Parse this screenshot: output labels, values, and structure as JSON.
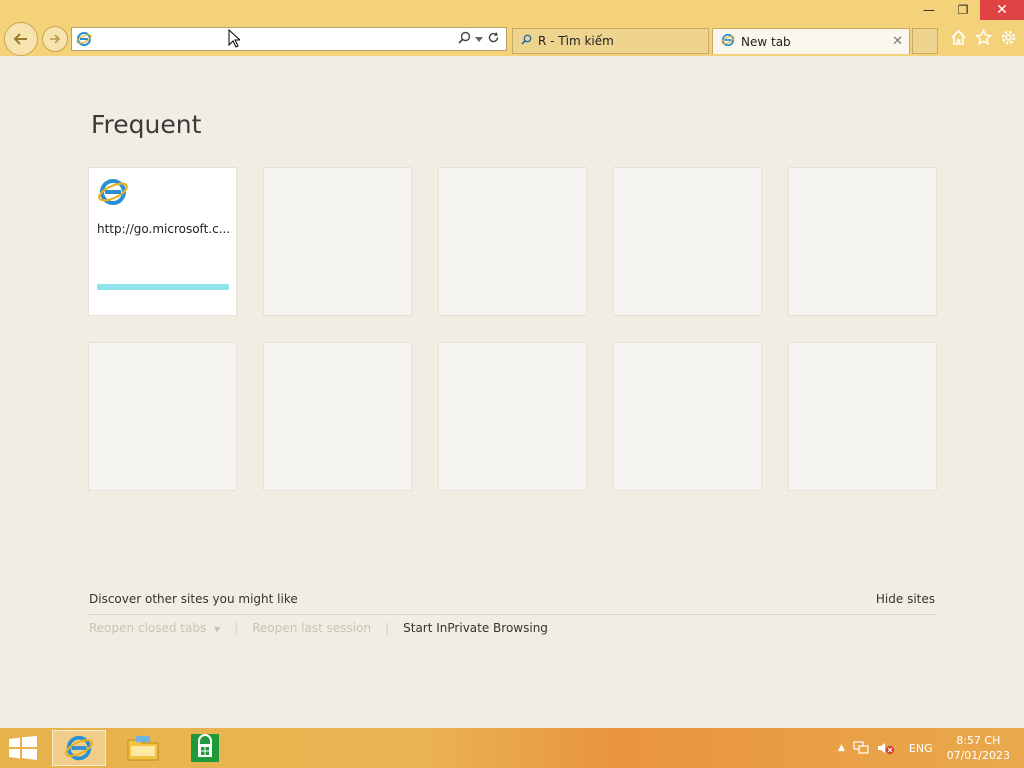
{
  "window": {
    "minimize": "—",
    "restore": "❐",
    "close": "✕"
  },
  "address_bar": {
    "value": "",
    "placeholder": ""
  },
  "tabs": [
    {
      "label": "R - Tìm kiếm"
    },
    {
      "label": "New tab"
    }
  ],
  "content": {
    "title": "Frequent",
    "tiles": [
      {
        "url": "http://go.microsoft.c...",
        "progress": 1.0
      },
      {
        "url": ""
      },
      {
        "url": ""
      },
      {
        "url": ""
      },
      {
        "url": ""
      },
      {
        "url": ""
      },
      {
        "url": ""
      },
      {
        "url": ""
      },
      {
        "url": ""
      },
      {
        "url": ""
      }
    ],
    "discover": "Discover other sites you might like",
    "hide_sites": "Hide sites",
    "reopen_closed": "Reopen closed tabs",
    "reopen_session": "Reopen last session",
    "inprivate": "Start InPrivate Browsing"
  },
  "taskbar": {
    "language": "ENG",
    "time": "8:57 CH",
    "date": "07/01/2023"
  },
  "colors": {
    "chrome": "#f4d27a",
    "page_bg": "#f2ede3",
    "progress": "#8fe3ec",
    "close_btn": "#e04343"
  }
}
